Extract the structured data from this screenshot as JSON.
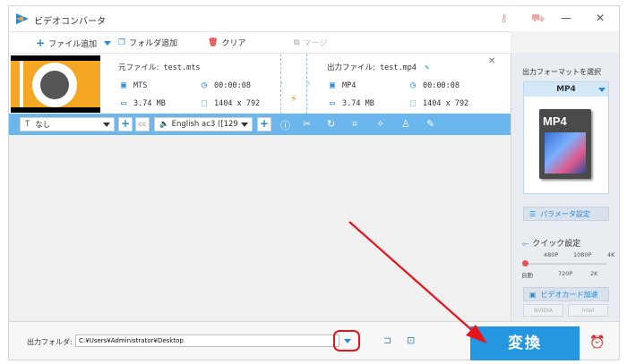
{
  "title": "ビデオコンバータ",
  "toolbar": {
    "add_file": "ファイル追加",
    "add_folder": "フォルダ追加",
    "clear": "クリア",
    "merge": "マージ"
  },
  "file": {
    "source_label": "元ファイル:",
    "source_name": "test.mts",
    "source_format": "MTS",
    "source_duration": "00:00:08",
    "source_size": "3.74 MB",
    "source_resolution": "1404 x 792",
    "output_label": "出力ファイル:",
    "output_name": "test.mp4",
    "output_format": "MP4",
    "output_duration": "00:00:08",
    "output_size": "3.74 MB",
    "output_resolution": "1404 x 792"
  },
  "trackbar": {
    "subtitle": "なし",
    "audio": "English ac3 ([129"
  },
  "right_panel": {
    "title": "出力フォーマットを選択",
    "format": "MP4",
    "format_art_label": "MP4",
    "params_button": "パラメータ設定",
    "quick_label": "クイック設定",
    "quick_top_ticks": [
      "480P",
      "1080P",
      "4K"
    ],
    "quick_bottom_ticks": [
      "自動",
      "720P",
      "2K"
    ],
    "gpu_button": "ビデオカード加速",
    "gpu_vendors": [
      "NVIDIA",
      "Intel"
    ]
  },
  "bottom": {
    "output_label": "出力フォルダ:",
    "output_path": "C:¥Users¥Administrator¥Desktop",
    "convert": "変換"
  },
  "colors": {
    "accent": "#2596e0",
    "trackbar": "#6cb6ee",
    "annotation": "#e8141c"
  }
}
